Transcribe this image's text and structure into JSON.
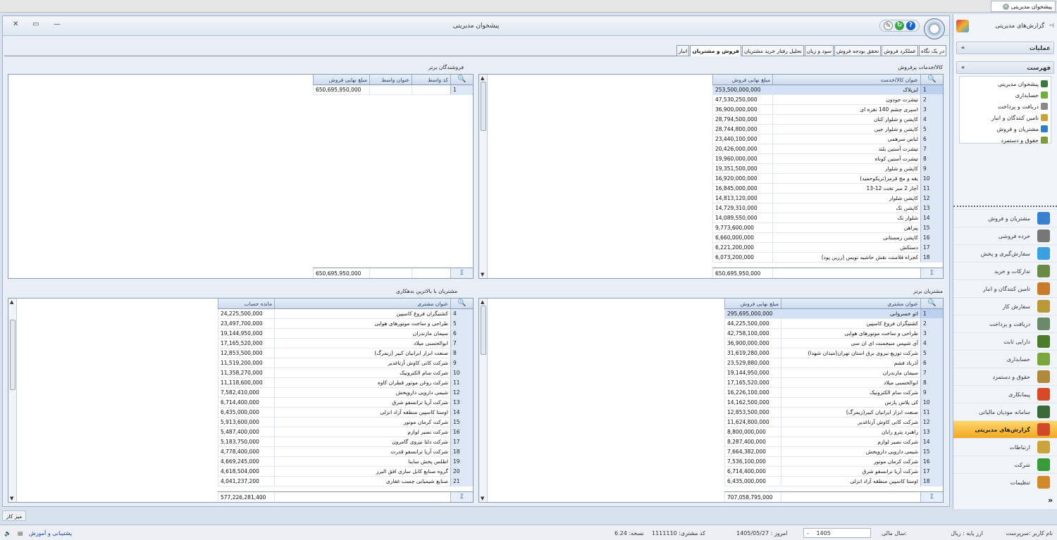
{
  "app_tab": {
    "label": "پیشخوان مدیریتی",
    "close": "×"
  },
  "window": {
    "title": "پیشخوان مدیریتی",
    "close": "✕",
    "restore": "▭",
    "minimize": "—"
  },
  "tabs": [
    "در یک نگاه",
    "عملکرد فروش",
    "تحقق بودجه فروش",
    "سود و زیان",
    "تحلیل رفتار خرید مشتریان",
    "فروش و مشتریان",
    "انبار"
  ],
  "active_tab": "فروش و مشتریان",
  "top_products": {
    "title": "کالا/خدمات پرفروش",
    "headers": [
      "عنوان کالا/خدمت",
      "مبلغ نهایی فروش"
    ],
    "rows": [
      {
        "n": "1",
        "name": "ایزیلاک",
        "value": "253,500,000,000"
      },
      {
        "n": "2",
        "name": "تیشرت جودون",
        "value": "47,530,250,000"
      },
      {
        "n": "3",
        "name": "اسپری چشم 140 نقره ای",
        "value": "36,900,000,000"
      },
      {
        "n": "4",
        "name": "کاپشن و شلوار کتان",
        "value": "28,794,500,000"
      },
      {
        "n": "5",
        "name": "کاپشن و شلوار جین",
        "value": "28,744,800,000"
      },
      {
        "n": "6",
        "name": "لباس سرهمی",
        "value": "23,440,100,000"
      },
      {
        "n": "7",
        "name": "تیشرت آستین بلند",
        "value": "20,426,000,000"
      },
      {
        "n": "8",
        "name": "تیشرت آستین کوتاه",
        "value": "19,960,000,000"
      },
      {
        "n": "9",
        "name": "کاپشن و شلوار",
        "value": "19,351,500,000"
      },
      {
        "n": "10",
        "name": "یقه و مچ قرمز(تریکوحمید)",
        "value": "16,920,000,000"
      },
      {
        "n": "11",
        "name": "آچار 2 سر تخت 12-13",
        "value": "16,845,000,000"
      },
      {
        "n": "12",
        "name": "کاپشن شلوار",
        "value": "14,813,120,000"
      },
      {
        "n": "13",
        "name": "کاپشن تک",
        "value": "14,729,310,000"
      },
      {
        "n": "14",
        "name": "شلوار تک",
        "value": "14,089,550,000"
      },
      {
        "n": "15",
        "name": "پیراهن",
        "value": "9,773,600,000"
      },
      {
        "n": "16",
        "name": "کاپشن زمستانی",
        "value": "6,660,000,000"
      },
      {
        "n": "17",
        "name": "دستکش",
        "value": "6,221,200,000"
      },
      {
        "n": "18",
        "name": "کجراه فلامنت نقش حاشیه نویس (زرین پود)",
        "value": "6,073,200,000"
      }
    ],
    "total": "650,695,950,000"
  },
  "top_sellers": {
    "title": "فروشندگان برتر",
    "headers": [
      "کد واسط",
      "عنوان واسط",
      "مبلغ نهایی فروش"
    ],
    "rows": [
      {
        "n": "1",
        "code": "",
        "name": "",
        "value": "650,695,950,000"
      }
    ],
    "total": "650,695,950,000"
  },
  "top_customers": {
    "title": "مشتریان برتر",
    "headers": [
      "عنوان مشتری",
      "مبلغ نهایی فروش"
    ],
    "rows": [
      {
        "n": "1",
        "name": "اتو خسروانی",
        "value": "295,695,000,000"
      },
      {
        "n": "2",
        "name": "کشتیگران فروغ کاسپین",
        "value": "44,225,500,000"
      },
      {
        "n": "3",
        "name": "طراحی و ساخت موتورهای هوایی",
        "value": "42,758,100,000"
      },
      {
        "n": "4",
        "name": "آی شیپس منیجمنت ای ان سی",
        "value": "36,900,000,000"
      },
      {
        "n": "5",
        "name": "شرکت توزیع نیروی برق استان تهران(میدان شهدا)",
        "value": "31,619,280,000"
      },
      {
        "n": "6",
        "name": "آذرباد فشم",
        "value": "23,529,880,000"
      },
      {
        "n": "7",
        "name": "سیمان مازندران",
        "value": "19,144,950,000"
      },
      {
        "n": "8",
        "name": "ابوالحسنی میلاد",
        "value": "17,165,520,000"
      },
      {
        "n": "9",
        "name": "شرکت سام الکترونیک",
        "value": "16,226,100,000"
      },
      {
        "n": "10",
        "name": "کی پلاس پارس",
        "value": "14,162,500,000"
      },
      {
        "n": "11",
        "name": "صنعت ابزار ایرانیان کبیر(زیمرگ)",
        "value": "12,853,500,000"
      },
      {
        "n": "12",
        "name": "شرکت کانی کاوش آرتاغدیر",
        "value": "11,624,800,000"
      },
      {
        "n": "13",
        "name": "راهبرد پترو رایان",
        "value": "8,800,000,000"
      },
      {
        "n": "14",
        "name": "شرکت نصیر لوازم",
        "value": "8,287,400,000"
      },
      {
        "n": "15",
        "name": "شیمی دارویی داروپخش",
        "value": "7,664,382,000"
      },
      {
        "n": "16",
        "name": "شرکت کرمان موتور",
        "value": "7,536,100,000"
      },
      {
        "n": "17",
        "name": "شرکت آریا ترانسفو شرق",
        "value": "6,714,400,000"
      },
      {
        "n": "18",
        "name": "اوستا کاسپین منطقه آزاد انزلی",
        "value": "6,435,000,000"
      }
    ],
    "total": "707,058,795,000"
  },
  "top_debtors": {
    "title": "مشتریان با بالاترین بدهکاری",
    "headers": [
      "عنوان مشتری",
      "مانده حساب"
    ],
    "rows": [
      {
        "n": "4",
        "name": "کشتیگران فروغ کاسپین",
        "value": "24,225,500,000"
      },
      {
        "n": "5",
        "name": "طراحی و ساخت موتورهای هوایی",
        "value": "23,497,700,000"
      },
      {
        "n": "6",
        "name": "سیمان مازندران",
        "value": "19,144,950,000"
      },
      {
        "n": "7",
        "name": "ابوالحسنی میلاد",
        "value": "17,165,520,000"
      },
      {
        "n": "8",
        "name": "صنعت ابزار ایرانیان کبیر (زیمرگ)",
        "value": "12,853,500,000"
      },
      {
        "n": "9",
        "name": "شرکت کانی کاوش آرتاغدیر",
        "value": "11,519,200,000"
      },
      {
        "n": "10",
        "name": "شرکت سام الکترونیک",
        "value": "11,358,270,000"
      },
      {
        "n": "11",
        "name": "شرکت روغن موتور قطران کاوه",
        "value": "11,118,600,000"
      },
      {
        "n": "12",
        "name": "شیمی دارویی داروپخش",
        "value": "7,582,410,000"
      },
      {
        "n": "13",
        "name": "شرکت آریا ترانسفو شرق",
        "value": "6,714,400,000"
      },
      {
        "n": "14",
        "name": "اوستا کاسپین منطقه آزاد انزلی",
        "value": "6,435,000,000"
      },
      {
        "n": "15",
        "name": "شرکت کرمان موتور",
        "value": "5,913,600,000"
      },
      {
        "n": "16",
        "name": "شرکت نصیر لوازم",
        "value": "5,487,400,000"
      },
      {
        "n": "17",
        "name": "شرکت دلتا نیروی گامرون",
        "value": "5,183,750,000"
      },
      {
        "n": "18",
        "name": "شرکت آریا ترانسفو قدرت",
        "value": "4,778,400,000"
      },
      {
        "n": "19",
        "name": "اطلس پخش ساینا",
        "value": "4,669,245,000"
      },
      {
        "n": "20",
        "name": "گروه صنایع کابل سازی افق البرز",
        "value": "4,618,504,000"
      },
      {
        "n": "21",
        "name": "صنایع شیمیایی چسب غفاری",
        "value": "4,041,237,200"
      }
    ],
    "total": "577,226,281,400"
  },
  "sidebar": {
    "pin_title": "گزارش‌های مدیریتی",
    "operations": "عملیات",
    "list_title": "فهرست",
    "list_items": [
      "پیشخوان مدیریتی",
      "حسابداری",
      "دریافت و پرداخت",
      "تامین کنندگان و انبار",
      "مشتریان و فروش",
      "حقوق و دستمزد"
    ],
    "nav": [
      "مشتریان و فروش",
      "خرده فروشی",
      "سفارش‌گیری و پخش",
      "تدارکات و خرید",
      "تامین کنندگان و انبار",
      "سفارش کار",
      "دریافت و پرداخت",
      "دارایی ثابت",
      "حسابداری",
      "حقوق و دستمزد",
      "پیمانکاری",
      "سامانه مودیان مالیاتی",
      "گزارش‌های مدیریتی",
      "ارتباطات",
      "شرکت",
      "تنظیمات"
    ],
    "active_nav": "گزارش‌های مدیریتی",
    "collapse": "»"
  },
  "desk_button": "میز کار",
  "status": {
    "user": "نام کاربر :سرپرست",
    "currency": "ارز پایه : ریال",
    "fiscal_label": "سال مالی:",
    "fiscal_year": "1405",
    "fiscal_dash": "-",
    "today": "امروز : 1405/05/27",
    "customer_code": "کد مشتری: 1111110",
    "version": "نسخه: 6.24",
    "support": "پشتیبانی و آموزش"
  },
  "colors": {
    "accent": "#f5a623",
    "header": "#cfdcee",
    "selected": "#d2e1f6"
  }
}
